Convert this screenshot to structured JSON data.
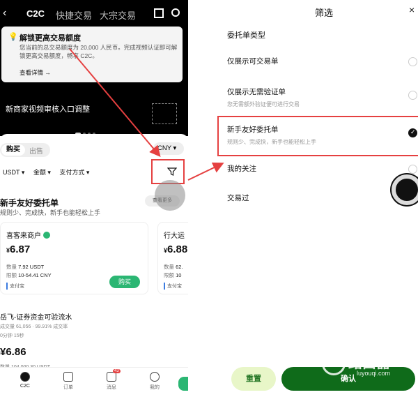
{
  "left": {
    "nav": {
      "back": "‹",
      "tabs": [
        "C2C",
        "快捷交易",
        "大宗交易"
      ]
    },
    "notice": {
      "title": "解锁更高交易额度",
      "body": "您当前的总交易额度为 20,000 人民币。完成视频认证即可解锁更高交易额度，畅享 C2C。",
      "link": "查看详情 →"
    },
    "banner": "新商家视频审核入口调整",
    "segment": {
      "buy": "购买",
      "sell": "出售"
    },
    "currency": "CNY ▾",
    "filters": [
      "USDT ▾",
      "金额 ▾",
      "支付方式 ▾"
    ],
    "section": {
      "title": "新手友好委托单",
      "subtitle": "规则少、完成快，新手也能轻松上手",
      "view_more": "查看更多"
    },
    "card1": {
      "name": "喜客来商户",
      "price_symbol": "¥",
      "price": "6.87",
      "qty_label": "数量",
      "qty": "7.92 USDT",
      "limit_label": "限额",
      "limit": "10-54.41 CNY",
      "pay": "支付宝",
      "buy": "购买"
    },
    "card2": {
      "name": "行大运",
      "price": "6.88",
      "qty": "62.",
      "limit": "10",
      "pay": "支付宝"
    },
    "row2": {
      "name": "岳飞-证券资金可验流水",
      "meta": "成交量 61,056 · 99.91% 成交率",
      "meta2": "0分钟 15秒",
      "price": "6.86",
      "qty": "数量 104,000.30 USDT"
    },
    "bottom_nav": [
      {
        "label": "C2C"
      },
      {
        "label": "订单"
      },
      {
        "label": "消息",
        "badge": "43"
      },
      {
        "label": "我的"
      }
    ]
  },
  "right": {
    "title": "筛选",
    "close": "×",
    "section": "委托单类型",
    "options": [
      {
        "label": "仅展示可交易单",
        "sub": "",
        "selected": false
      },
      {
        "label": "仅展示无需验证单",
        "sub": "您无需额外验证便可进行交易",
        "selected": false
      },
      {
        "label": "新手友好委托单",
        "sub": "规则少、完成快，新手也能轻松上手",
        "selected": true
      },
      {
        "label": "我的关注",
        "sub": "",
        "selected": false
      },
      {
        "label": "交易过",
        "sub": "",
        "selected": false
      }
    ],
    "reset": "重置",
    "confirm": "确认"
  },
  "watermark": {
    "text": "路由器",
    "url": "luyouqi.com"
  },
  "colors": {
    "highlight": "#e54040",
    "green": "#2bb673",
    "dark_green": "#0f6b1a"
  }
}
